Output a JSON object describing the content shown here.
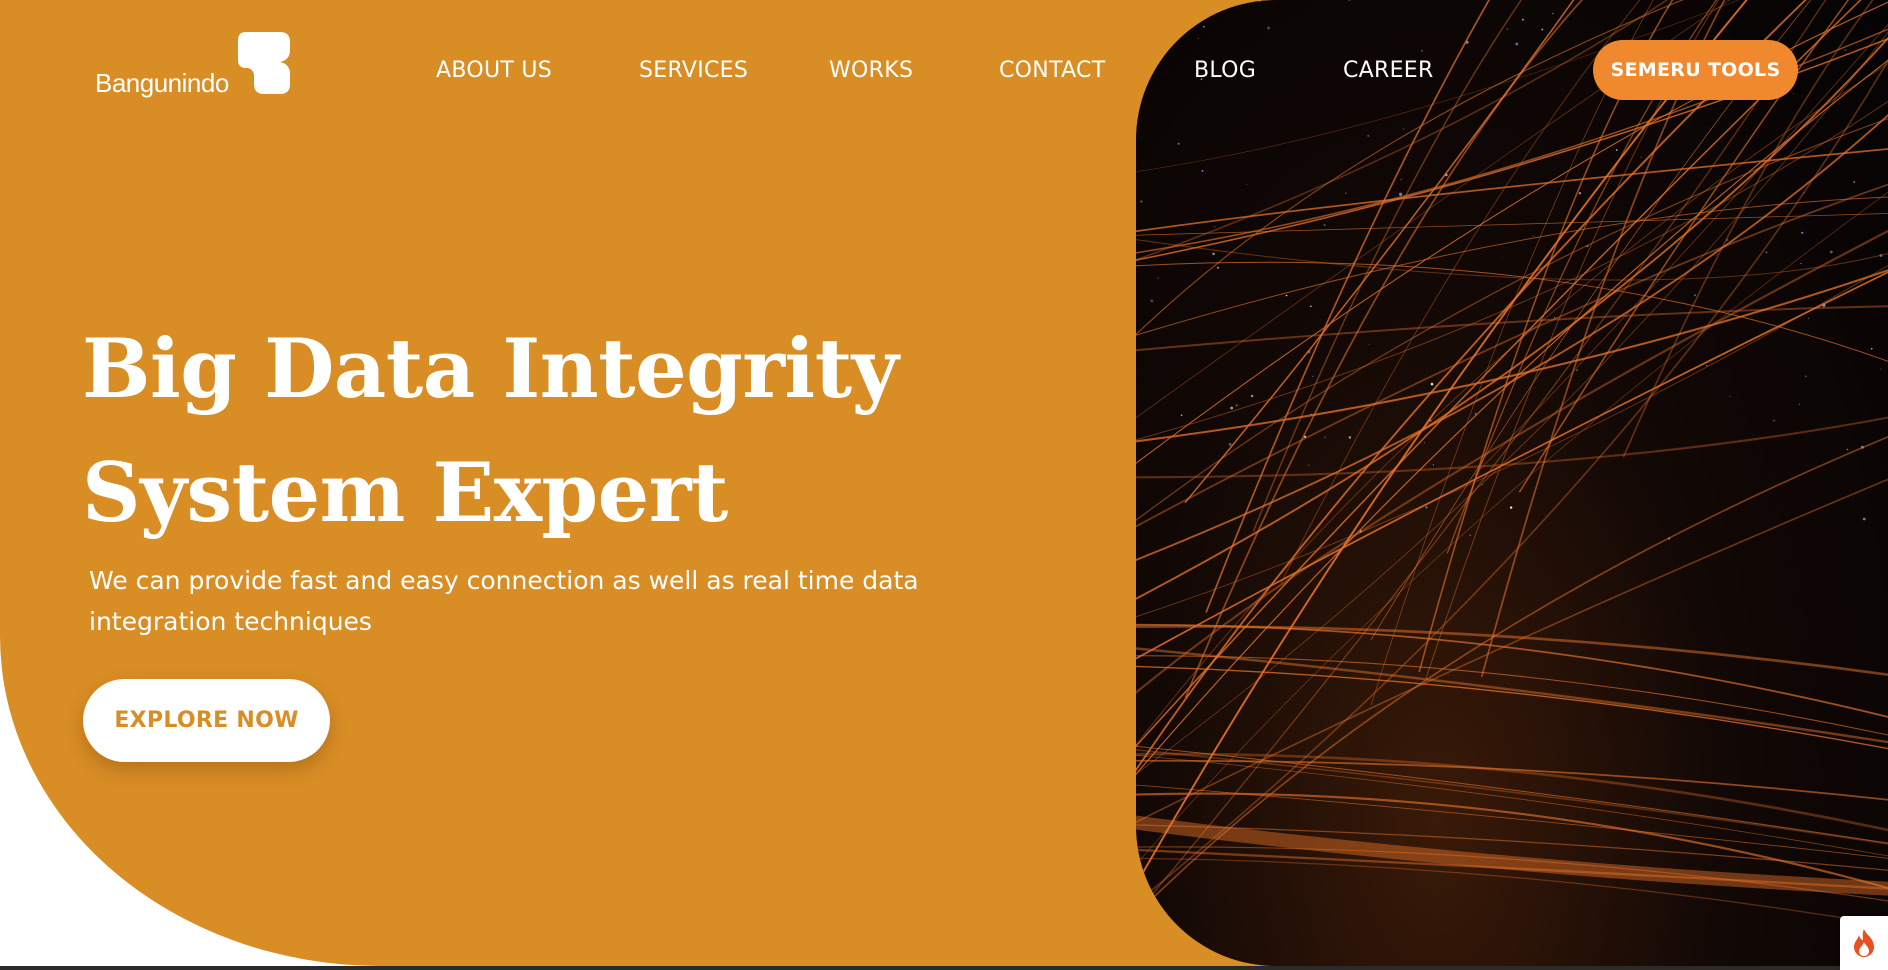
{
  "logo": {
    "text": "Bangunindo",
    "icon": "bangunindo-logo-mark"
  },
  "nav": {
    "items": [
      {
        "label": "ABOUT US"
      },
      {
        "label": "SERVICES"
      },
      {
        "label": "WORKS"
      },
      {
        "label": "CONTACT"
      },
      {
        "label": "BLOG"
      },
      {
        "label": "CAREER"
      }
    ],
    "cta_label": "SEMERU TOOLS"
  },
  "hero": {
    "headline_line1": "Big Data Integrity",
    "headline_line2": "System Expert",
    "subtitle": "We can provide fast and easy connection as well as real time data integration techniques",
    "button_label": "EXPLORE NOW",
    "image_icon": "light-trails-night-sky"
  },
  "badge": {
    "icon": "flame-icon"
  },
  "colors": {
    "primary_orange": "#d98d25",
    "cta_orange": "#f0892e",
    "text_white": "#ffffff",
    "image_dark": "#050304",
    "trail_orange": "#e8742a"
  }
}
